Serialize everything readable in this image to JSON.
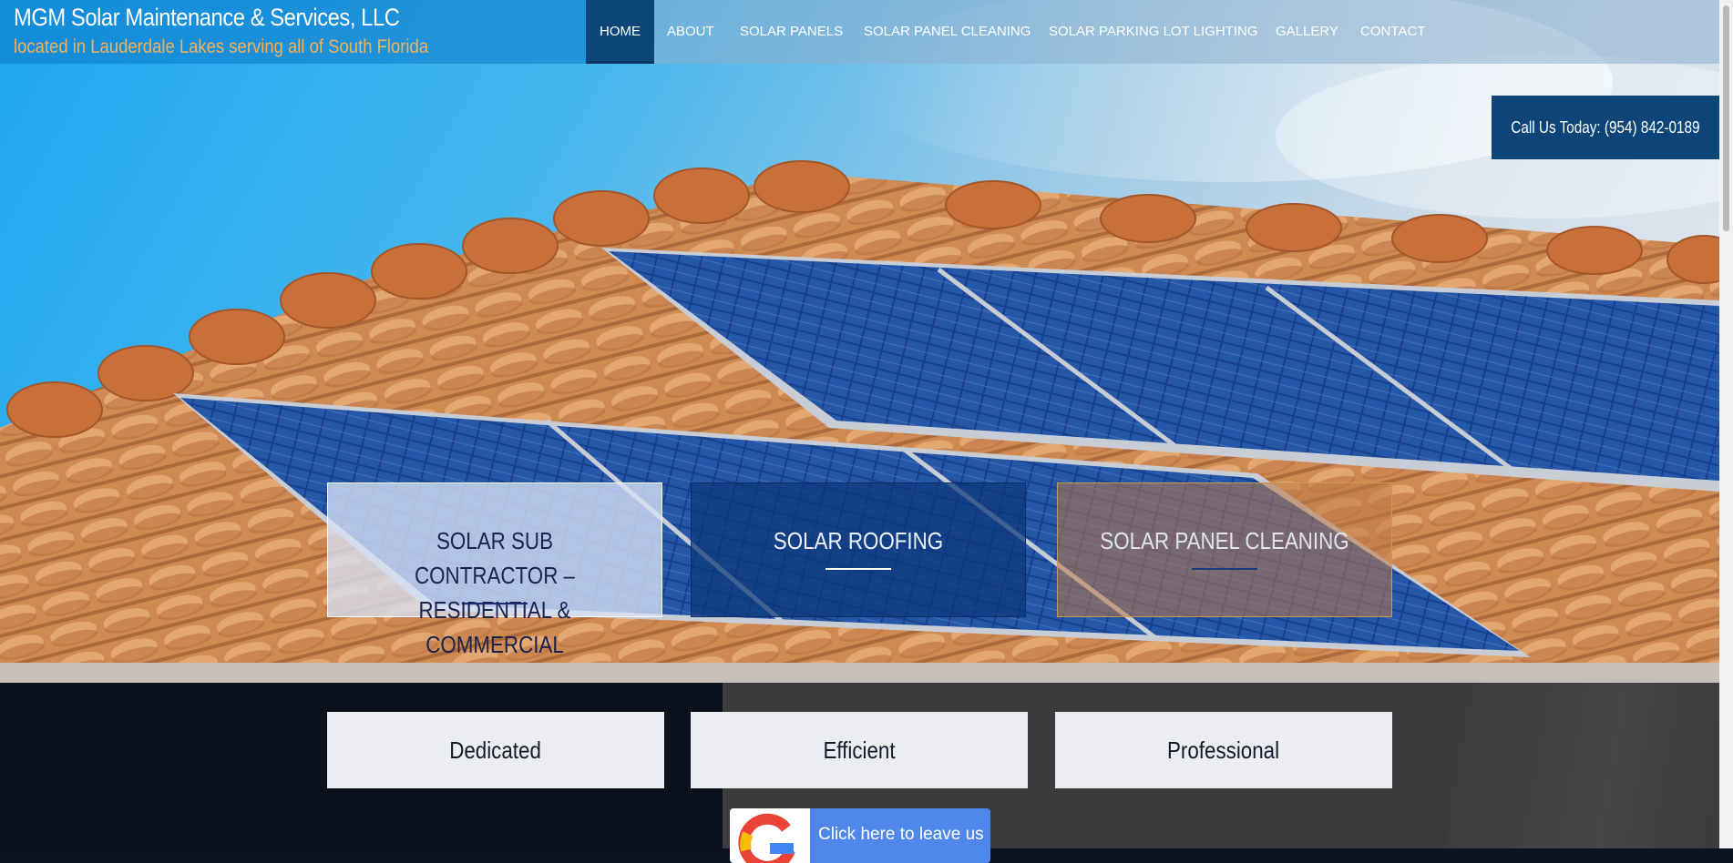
{
  "header": {
    "title": "MGM Solar Maintenance & Services, LLC",
    "subtitle": "located in Lauderdale Lakes serving all of South Florida"
  },
  "nav": {
    "items": [
      {
        "label": "HOME",
        "active": true
      },
      {
        "label": "ABOUT"
      },
      {
        "label": "SOLAR PANELS"
      },
      {
        "label": "SOLAR PANEL CLEANING"
      },
      {
        "label": "SOLAR PARKING LOT LIGHTING"
      },
      {
        "label": "GALLERY"
      },
      {
        "label": "CONTACT"
      }
    ]
  },
  "call_button": "Call Us Today: (954) 842-0189",
  "features": [
    {
      "label": "SOLAR SUB CONTRACTOR – RESIDENTIAL & COMMERCIAL"
    },
    {
      "label": "SOLAR ROOFING"
    },
    {
      "label": "SOLAR PANEL CLEANING"
    }
  ],
  "values": [
    "Dedicated",
    "Efficient",
    "Professional"
  ],
  "review": {
    "icon": "google-g-icon",
    "label": "Click here to leave us"
  },
  "colors": {
    "nav_active": "#0c4578",
    "accent_orange": "#f2b25a",
    "call_bg": "#0d4579",
    "review_blue": "#4f88ea"
  }
}
